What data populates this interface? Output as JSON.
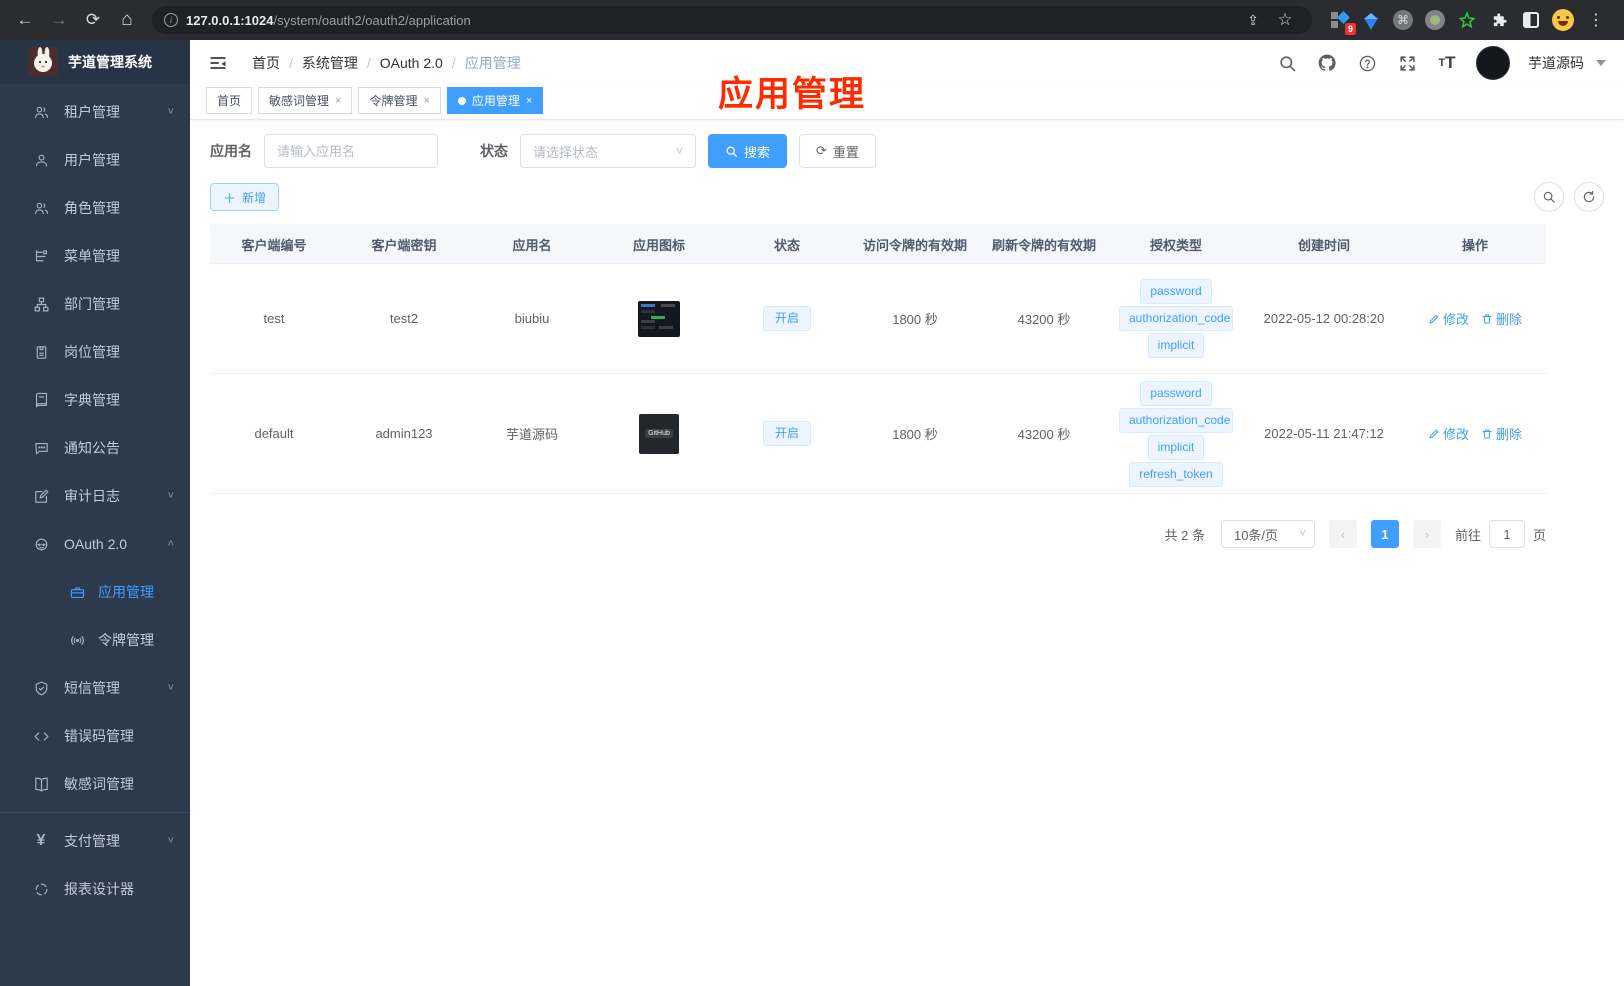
{
  "colors": {
    "accent": "#409eff",
    "sidebar_bg": "#2d3a4d",
    "annotation_red": "#ff2b00",
    "tag_bg": "#ecf5ff"
  },
  "browser": {
    "url_host": "127.0.0.1:1024",
    "url_path": "/system/oauth2/oauth2/application",
    "extension_badge": "9"
  },
  "sidebar": {
    "app_title": "芋道管理系统",
    "items": [
      {
        "label": "租户管理",
        "expandable": true
      },
      {
        "label": "用户管理"
      },
      {
        "label": "角色管理"
      },
      {
        "label": "菜单管理"
      },
      {
        "label": "部门管理"
      },
      {
        "label": "岗位管理"
      },
      {
        "label": "字典管理"
      },
      {
        "label": "通知公告"
      },
      {
        "label": "审计日志",
        "expandable": true
      },
      {
        "label": "OAuth 2.0",
        "expandable": true,
        "expanded": true
      },
      {
        "label": "应用管理",
        "sub": true,
        "active": true
      },
      {
        "label": "令牌管理",
        "sub": true
      },
      {
        "label": "短信管理",
        "expandable": true
      },
      {
        "label": "错误码管理"
      },
      {
        "label": "敏感词管理"
      },
      {
        "label": "支付管理",
        "expandable": true
      },
      {
        "label": "报表设计器"
      }
    ]
  },
  "header": {
    "breadcrumb": [
      "首页",
      "系统管理",
      "OAuth 2.0",
      "应用管理"
    ],
    "username": "芋道源码"
  },
  "tabs": [
    {
      "label": "首页"
    },
    {
      "label": "敏感词管理"
    },
    {
      "label": "令牌管理"
    },
    {
      "label": "应用管理",
      "active": true
    }
  ],
  "annotation": {
    "text": "应用管理"
  },
  "filters": {
    "name_label": "应用名",
    "name_placeholder": "请输入应用名",
    "status_label": "状态",
    "status_placeholder": "请选择状态",
    "search_label": "搜索",
    "reset_label": "重置"
  },
  "toolbar": {
    "add_label": "新增"
  },
  "table": {
    "columns": [
      "客户端编号",
      "客户端密钥",
      "应用名",
      "应用图标",
      "状态",
      "访问令牌的有效期",
      "刷新令牌的有效期",
      "授权类型",
      "创建时间",
      "操作"
    ],
    "rows": [
      {
        "client_id": "test",
        "secret": "test2",
        "name": "biubiu",
        "icon": "dashboard-screenshot",
        "status": "开启",
        "access_ttl": "1800 秒",
        "refresh_ttl": "43200 秒",
        "grants": [
          "password",
          "authorization_code",
          "implicit"
        ],
        "created": "2022-05-12 00:28:20",
        "edit_label": "修改",
        "delete_label": "删除"
      },
      {
        "client_id": "default",
        "secret": "admin123",
        "name": "芋道源码",
        "icon": "github-dark",
        "icon_text": "GitHub",
        "status": "开启",
        "access_ttl": "1800 秒",
        "refresh_ttl": "43200 秒",
        "grants": [
          "password",
          "authorization_code",
          "implicit",
          "refresh_token"
        ],
        "created": "2022-05-11 21:47:12",
        "edit_label": "修改",
        "delete_label": "删除"
      }
    ]
  },
  "pagination": {
    "total": "共 2 条",
    "page_size": "10条/页",
    "current_page": "1",
    "goto_label": "前往",
    "goto_value": "1",
    "page_suffix": "页"
  }
}
